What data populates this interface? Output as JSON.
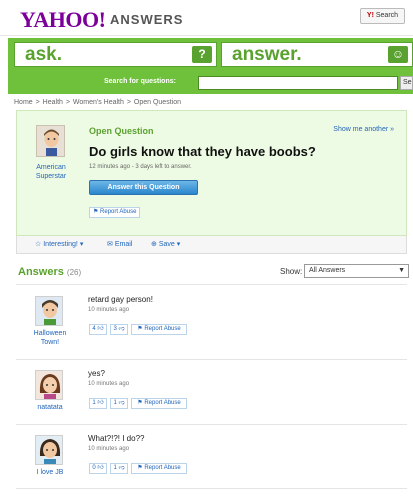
{
  "header": {
    "logo": "YAHOO!",
    "logo_sub": "ANSWERS",
    "search_button": "Search"
  },
  "ask_box": {
    "label": "ask.",
    "icon": "?"
  },
  "answer_box": {
    "label": "answer.",
    "icon": "☺"
  },
  "search_bar": {
    "label": "Search for questions:",
    "button": "Se"
  },
  "breadcrumb": [
    "Home",
    "Health",
    "Women's Health",
    "Open Question"
  ],
  "question": {
    "status": "Open Question",
    "show_me_another": "Show me another »",
    "title": "Do girls know that they have boobs?",
    "meta": "12 minutes ago - 3 days left to answer.",
    "asker": "American Superstar",
    "answer_button": "Answer this Question",
    "report_abuse": "Report Abuse"
  },
  "actions": {
    "interesting": "Interesting!",
    "email": "Email",
    "save": "Save"
  },
  "answers_section": {
    "title": "Answers",
    "count": "(26)",
    "show_label": "Show:",
    "show_value": "All Answers"
  },
  "answers": [
    {
      "name": "Halloween Town!",
      "text": "retard gay person!",
      "time": "10 minutes ago",
      "up": "4",
      "down": "3",
      "report": "Report Abuse"
    },
    {
      "name": "natatata",
      "text": "yes?",
      "time": "10 minutes ago",
      "up": "1",
      "down": "1",
      "report": "Report Abuse"
    },
    {
      "name": "I love JB",
      "text": "What?!?! I do??",
      "time": "10 minutes ago",
      "up": "0",
      "down": "1",
      "report": "Report Abuse"
    }
  ],
  "colors": {
    "brand_purple": "#7b0099",
    "green": "#6fc13b",
    "link_blue": "#2266bb"
  }
}
